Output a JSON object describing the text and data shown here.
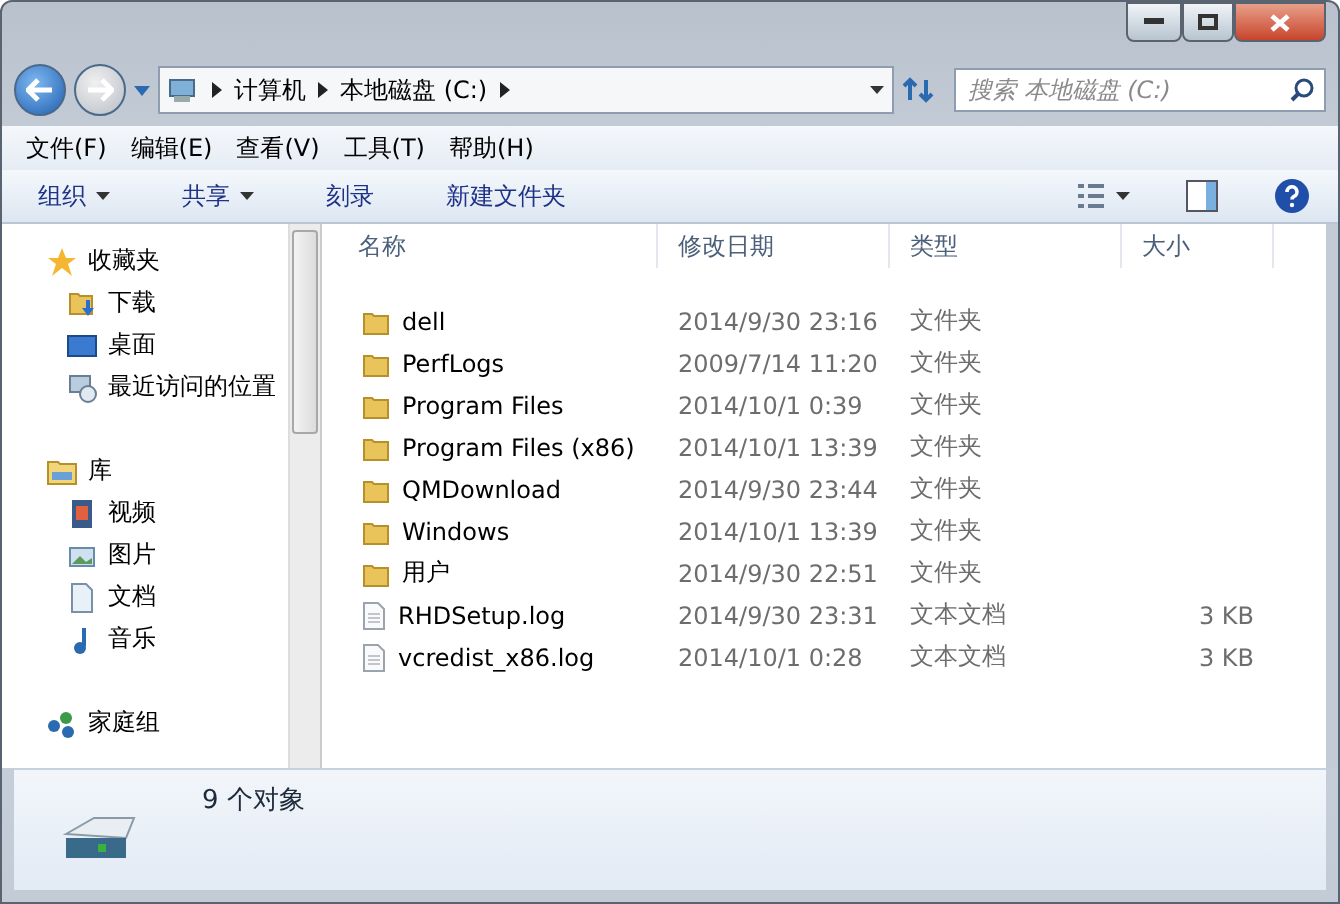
{
  "address": {
    "crumbs": [
      "计算机",
      "本地磁盘 (C:)"
    ]
  },
  "search": {
    "placeholder": "搜索 本地磁盘 (C:)"
  },
  "menu": [
    "文件(F)",
    "编辑(E)",
    "查看(V)",
    "工具(T)",
    "帮助(H)"
  ],
  "toolbar": [
    {
      "label": "组织",
      "dropdown": true
    },
    {
      "label": "共享",
      "dropdown": true
    },
    {
      "label": "刻录",
      "dropdown": false
    },
    {
      "label": "新建文件夹",
      "dropdown": false
    }
  ],
  "sidebar": {
    "groups": [
      {
        "label": "收藏夹",
        "children": [
          {
            "label": "下载"
          },
          {
            "label": "桌面"
          },
          {
            "label": "最近访问的位置"
          }
        ]
      },
      {
        "label": "库",
        "children": [
          {
            "label": "视频"
          },
          {
            "label": "图片"
          },
          {
            "label": "文档"
          },
          {
            "label": "音乐"
          }
        ]
      },
      {
        "label": "家庭组"
      }
    ]
  },
  "table": {
    "columns": [
      "名称",
      "修改日期",
      "类型",
      "大小"
    ],
    "rows": [
      {
        "kind": "folder",
        "name": "dell",
        "date": "2014/9/30 23:16",
        "type": "文件夹"
      },
      {
        "kind": "folder",
        "name": "PerfLogs",
        "date": "2009/7/14 11:20",
        "type": "文件夹"
      },
      {
        "kind": "folder",
        "name": "Program Files",
        "date": "2014/10/1 0:39",
        "type": "文件夹"
      },
      {
        "kind": "folder",
        "name": "Program Files (x86)",
        "date": "2014/10/1 13:39",
        "type": "文件夹"
      },
      {
        "kind": "folder",
        "name": "QMDownload",
        "date": "2014/9/30 23:44",
        "type": "文件夹"
      },
      {
        "kind": "folder",
        "name": "Windows",
        "date": "2014/10/1 13:39",
        "type": "文件夹"
      },
      {
        "kind": "folder",
        "name": "用户",
        "date": "2014/9/30 22:51",
        "type": "文件夹"
      },
      {
        "kind": "file",
        "name": "RHDSetup.log",
        "date": "2014/9/30 23:31",
        "type": "文本文档",
        "size": "3 KB"
      },
      {
        "kind": "file",
        "name": "vcredist_x86.log",
        "date": "2014/10/1 0:28",
        "type": "文本文档",
        "size": "3 KB"
      }
    ]
  },
  "status_bar": {
    "count": "9 个对象"
  }
}
